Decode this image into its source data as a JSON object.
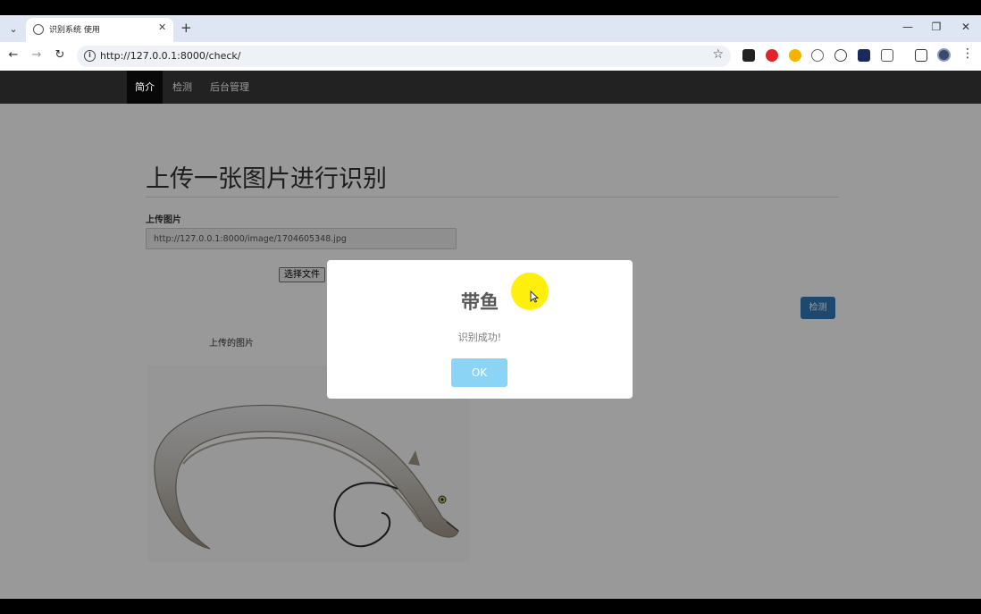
{
  "browser": {
    "tab_title": "识别系统 使用",
    "url": "http://127.0.0.1:8000/check/",
    "new_tab_glyph": "+",
    "close_glyph": "✕",
    "minimize_glyph": "—",
    "restore_glyph": "❐",
    "window_close_glyph": "✕",
    "back_glyph": "←",
    "forward_glyph": "→",
    "reload_glyph": "↻",
    "info_glyph": "i",
    "star_glyph": "☆",
    "menu_glyph": "⋮",
    "tab_menu_glyph": "⌄",
    "extension_colors": [
      "#222222",
      "#e0242b",
      "#f4b400",
      "#666666",
      "#444444",
      "#1a2a5a",
      "#555555",
      "#333333"
    ]
  },
  "navbar": {
    "items": [
      {
        "label": "简介",
        "active": true
      },
      {
        "label": "检测",
        "active": false
      },
      {
        "label": "后台管理",
        "active": false
      }
    ]
  },
  "main": {
    "heading": "上传一张图片进行识别",
    "upload_label": "上传图片",
    "image_url": "http://127.0.0.1:8000/image/1704605348.jpg",
    "file_button": "选择文件",
    "detect_button": "检测",
    "image_caption": "上传的图片"
  },
  "modal": {
    "title": "带鱼",
    "message": "识别成功!",
    "ok_label": "OK"
  },
  "colors": {
    "navbar_bg": "#222222",
    "detect_button": "#337ab7",
    "ok_button": "#8cd4f5",
    "cursor_highlight": "#ffee00"
  }
}
